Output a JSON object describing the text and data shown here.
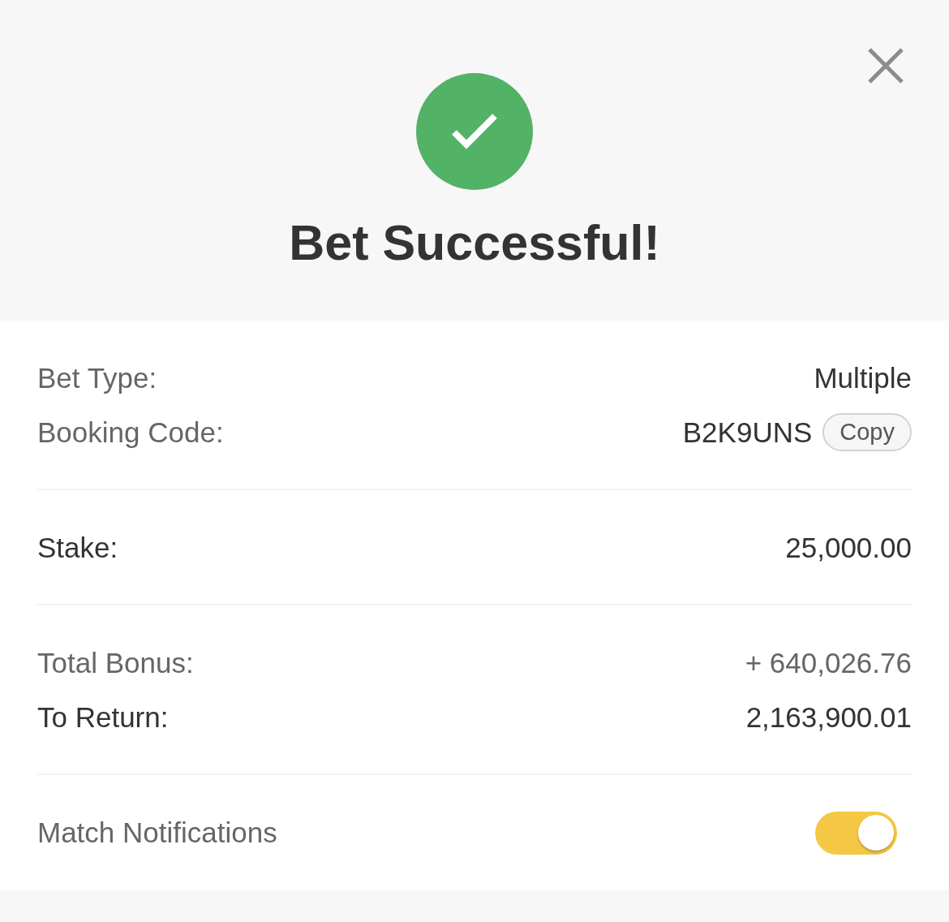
{
  "header": {
    "title": "Bet Successful!"
  },
  "sections": [
    {
      "rows": [
        {
          "kind": "info",
          "label": "Bet Type:",
          "value": "Multiple"
        },
        {
          "kind": "info",
          "label": "Booking Code:",
          "value": "B2K9UNS",
          "action": "Copy"
        }
      ]
    },
    {
      "rows": [
        {
          "kind": "total",
          "label": "Stake:",
          "value": "25,000.00"
        }
      ]
    },
    {
      "rows": [
        {
          "kind": "bonus",
          "label": "Total Bonus:",
          "value": "+ 640,026.76"
        },
        {
          "kind": "total",
          "label": "To Return:",
          "value": "2,163,900.01"
        }
      ]
    }
  ],
  "notifications": {
    "label": "Match Notifications",
    "on": true
  }
}
